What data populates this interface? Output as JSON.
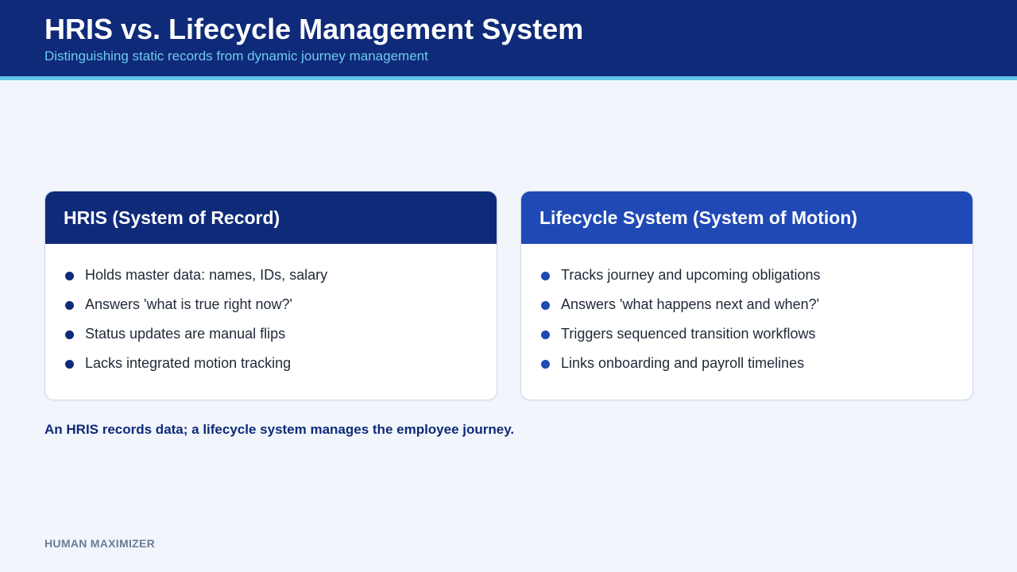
{
  "header": {
    "title": "HRIS vs. Lifecycle Management System",
    "subtitle": "Distinguishing static records from dynamic journey management"
  },
  "cards": [
    {
      "title": "HRIS (System of Record)",
      "items": [
        "Holds master data: names, IDs, salary",
        "Answers 'what is true right now?'",
        "Status updates are manual flips",
        "Lacks integrated motion tracking"
      ]
    },
    {
      "title": "Lifecycle System (System of Motion)",
      "items": [
        "Tracks journey and upcoming obligations",
        "Answers 'what happens next and when?'",
        "Triggers sequenced transition workflows",
        "Links onboarding and payroll timelines"
      ]
    }
  ],
  "summary": "An HRIS records data; a lifecycle system manages the employee journey.",
  "footer": {
    "brand": "HUMAN MAXIMIZER"
  },
  "colors": {
    "header_bg": "#0f2a78",
    "accent_line": "#5fc3e6",
    "card_left_header": "#0f2a78",
    "card_right_header": "#2049b5",
    "page_bg": "#f2f6fc"
  }
}
